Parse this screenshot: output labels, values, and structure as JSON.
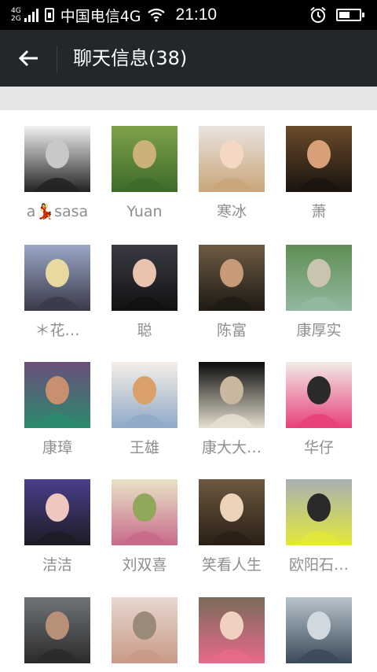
{
  "status_bar": {
    "network_top": "4G",
    "network_bottom": "2G",
    "carrier": "中国电信4G",
    "time": "21:10",
    "battery_level": 0.55
  },
  "header": {
    "title": "聊天信息(38)"
  },
  "members": [
    {
      "name": "a💃sasa",
      "colors": [
        "#f2f2f2",
        "#222222",
        "#c8c8c8"
      ]
    },
    {
      "name": "Yuan",
      "colors": [
        "#7fa24a",
        "#3e6b2a",
        "#c9b27a"
      ]
    },
    {
      "name": "寒冰",
      "colors": [
        "#e9e4e0",
        "#c9a57a",
        "#f4d8c4"
      ]
    },
    {
      "name": "萧",
      "colors": [
        "#6a4a2a",
        "#1a1410",
        "#d8a078"
      ]
    },
    {
      "name": "＊花…",
      "colors": [
        "#9aa7c6",
        "#3a3a4a",
        "#e8d9a0"
      ]
    },
    {
      "name": "聪",
      "colors": [
        "#3a3a44",
        "#121212",
        "#e9c3b0"
      ]
    },
    {
      "name": "陈富",
      "colors": [
        "#6d5b43",
        "#1f1a14",
        "#c79a78"
      ]
    },
    {
      "name": "康厚实",
      "colors": [
        "#5f8e55",
        "#93b8a0",
        "#c9c4b0"
      ]
    },
    {
      "name": "康璋",
      "colors": [
        "#6a4f7a",
        "#2b8a6e",
        "#c99070"
      ]
    },
    {
      "name": "王雄",
      "colors": [
        "#f4efe6",
        "#8fa9c8",
        "#d9a06a"
      ]
    },
    {
      "name": "康大大…",
      "colors": [
        "#0a0a0a",
        "#e6e0d0",
        "#c9b8a0"
      ]
    },
    {
      "name": "华仔",
      "colors": [
        "#f1ece6",
        "#e83f7a",
        "#2a2a2a"
      ]
    },
    {
      "name": "洁洁",
      "colors": [
        "#4a3f8c",
        "#1c1c24",
        "#efc6c0"
      ]
    },
    {
      "name": "刘双喜",
      "colors": [
        "#e9e3c8",
        "#c86a8a",
        "#8fa85a"
      ]
    },
    {
      "name": "笑看人生",
      "colors": [
        "#6b5840",
        "#2a2016",
        "#ecd2b8"
      ]
    },
    {
      "name": "欧阳石…",
      "colors": [
        "#a8b0b4",
        "#e3e83a",
        "#2a2a2a"
      ]
    },
    {
      "name": "",
      "colors": [
        "#6f7478",
        "#2a2a2a",
        "#b89078"
      ]
    },
    {
      "name": "",
      "colors": [
        "#e6d7cf",
        "#c99a88",
        "#9a8a7a"
      ]
    },
    {
      "name": "",
      "colors": [
        "#7a6a5a",
        "#e86a8a",
        "#f0d0c0"
      ]
    },
    {
      "name": "",
      "colors": [
        "#b8c4cc",
        "#3a4a5a",
        "#d0d8e0"
      ]
    }
  ]
}
